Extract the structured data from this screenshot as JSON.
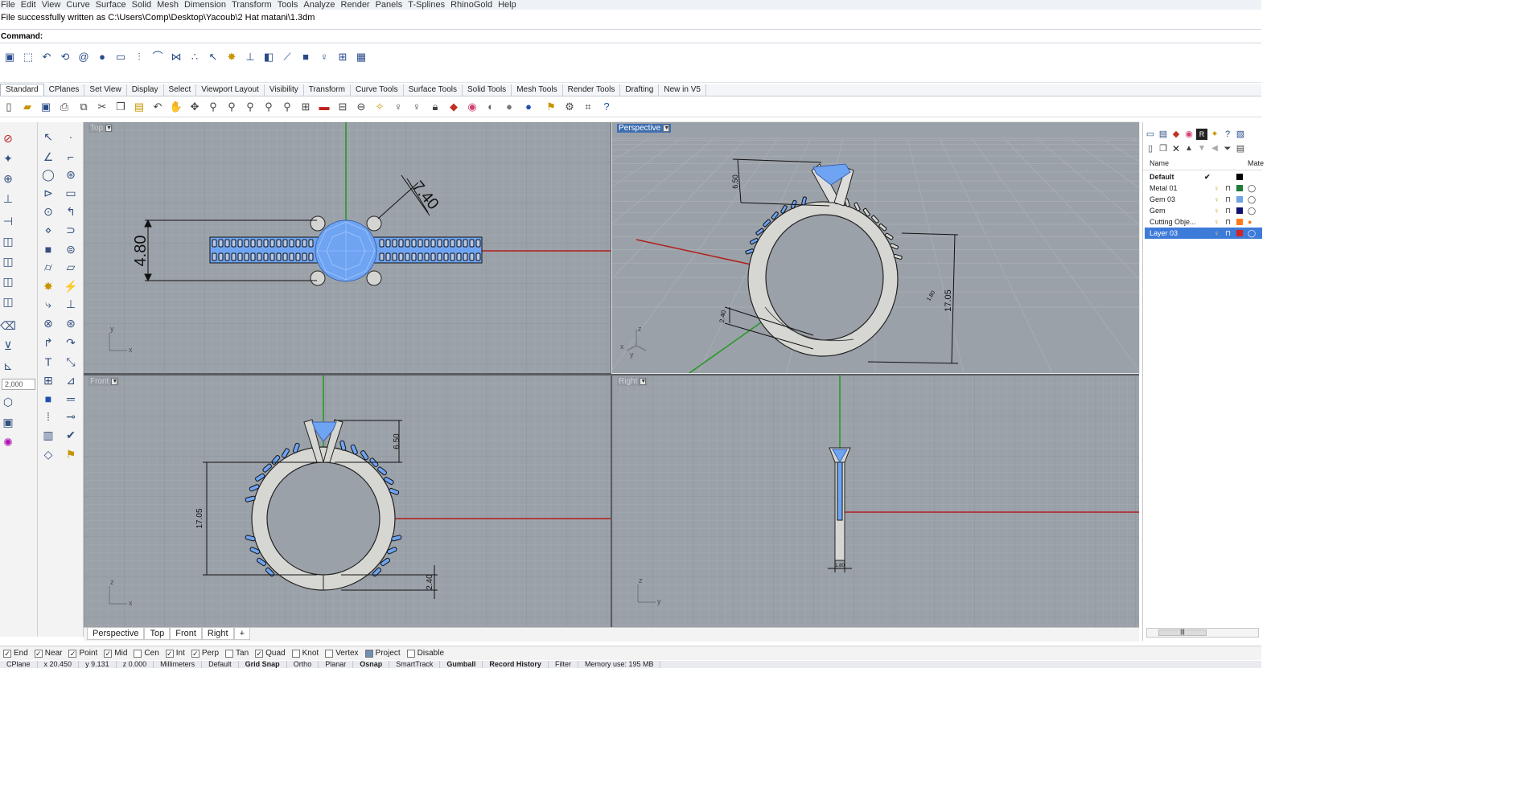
{
  "menu": [
    "File",
    "Edit",
    "View",
    "Curve",
    "Surface",
    "Solid",
    "Mesh",
    "Dimension",
    "Transform",
    "Tools",
    "Analyze",
    "Render",
    "Panels",
    "T-Splines",
    "RhinoGold",
    "Help"
  ],
  "history_line": "File successfully written as C:\\Users\\Comp\\Desktop\\Yacoub\\2 Hat matani\\1.3dm",
  "command_label": "Command:",
  "toolbar_tabs": [
    "Standard",
    "CPlanes",
    "Set View",
    "Display",
    "Select",
    "Viewport Layout",
    "Visibility",
    "Transform",
    "Curve Tools",
    "Surface Tools",
    "Solid Tools",
    "Mesh Tools",
    "Render Tools",
    "Drafting",
    "New in V5"
  ],
  "icons": {
    "top_row": [
      "save-icon",
      "select-window-icon",
      "undo-icon",
      "rotate-icon",
      "spiral-icon",
      "sphere-icon",
      "ruler-icon",
      "array-icon",
      "curve-icon",
      "network-icon",
      "cursor-icon",
      "gear-icon",
      "extrude-icon",
      "cube-icon",
      "gem-cube-icon",
      "bulb-icon",
      "grid-icon",
      "image-icon"
    ],
    "standard_row": [
      "new-icon",
      "open-icon",
      "save-icon",
      "print-icon",
      "import-icon",
      "cut-icon",
      "copy-icon",
      "paste-icon",
      "undo-icon",
      "pan-icon",
      "move-icon",
      "zoom-icon",
      "zoom-window-icon",
      "zoom-extents-icon",
      "zoom-selected-icon",
      "four-views-icon",
      "car-icon",
      "cplane-icon",
      "snapshot-icon",
      "light-icon",
      "bulb-icon",
      "lock-icon",
      "material-icon",
      "color-wheel-icon",
      "shade-icon",
      "render-sphere-icon",
      "blue-sphere-icon",
      "brush-icon",
      "options-icon",
      "help-icon"
    ]
  },
  "left_num": "2,000",
  "viewports": {
    "top": "Top",
    "perspective": "Perspective",
    "front": "Front",
    "right": "Right"
  },
  "dimensions": {
    "top_a": "7.40",
    "top_b": "4.80",
    "persp_a": "6.50",
    "persp_b": "17.05",
    "persp_c": "2.40",
    "persp_d": "1.80",
    "front_a": "6.50",
    "front_b": "17.05",
    "front_c": "2.40",
    "right_a": "1.80"
  },
  "axes": {
    "x": "x",
    "y": "y",
    "z": "z"
  },
  "viewport_tabs": [
    "Perspective",
    "Top",
    "Front",
    "Right",
    "+"
  ],
  "layers": {
    "header_name": "Name",
    "header_mat": "Mate",
    "rows": [
      {
        "name": "Default",
        "current": true,
        "color": "#000000"
      },
      {
        "name": "Metal 01",
        "color": "#1f7a3a"
      },
      {
        "name": "Gem 03",
        "color": "#6fa5e6"
      },
      {
        "name": "Gem",
        "color": "#101070"
      },
      {
        "name": "Cutting Obje...",
        "color": "#ff7a1a"
      },
      {
        "name": "Layer 03",
        "color": "#d42323",
        "selected": true
      }
    ],
    "checkmark": "✔",
    "scroll_thumb": "|||"
  },
  "osnaps": [
    {
      "label": "End",
      "on": true
    },
    {
      "label": "Near",
      "on": true
    },
    {
      "label": "Point",
      "on": true
    },
    {
      "label": "Mid",
      "on": true
    },
    {
      "label": "Cen",
      "on": false
    },
    {
      "label": "Int",
      "on": true
    },
    {
      "label": "Perp",
      "on": true
    },
    {
      "label": "Tan",
      "on": false
    },
    {
      "label": "Quad",
      "on": true
    },
    {
      "label": "Knot",
      "on": false
    },
    {
      "label": "Vertex",
      "on": false
    },
    {
      "label": "Project",
      "on": true
    },
    {
      "label": "Disable",
      "on": false
    }
  ],
  "status": {
    "cplane": "CPlane",
    "x": "x 20.450",
    "y": "y 9.131",
    "z": "z 0.000",
    "units": "Millimeters",
    "layer": "Default",
    "grid_snap": "Grid Snap",
    "ortho": "Ortho",
    "planar": "Planar",
    "osnap": "Osnap",
    "smarttrack": "SmartTrack",
    "gumball": "Gumball",
    "record_history": "Record History",
    "filter": "Filter",
    "memory": "Memory use: 195 MB"
  },
  "colors": {
    "viewport_bg": "#9ba1a8",
    "grid_minor": "#a7adb4",
    "grid_major": "#8c9299",
    "x_axis": "#b21e1e",
    "y_axis": "#1e9a1e",
    "gem": "#6ea4f2",
    "metal": "#d9d9d6",
    "dim": "#111111"
  }
}
